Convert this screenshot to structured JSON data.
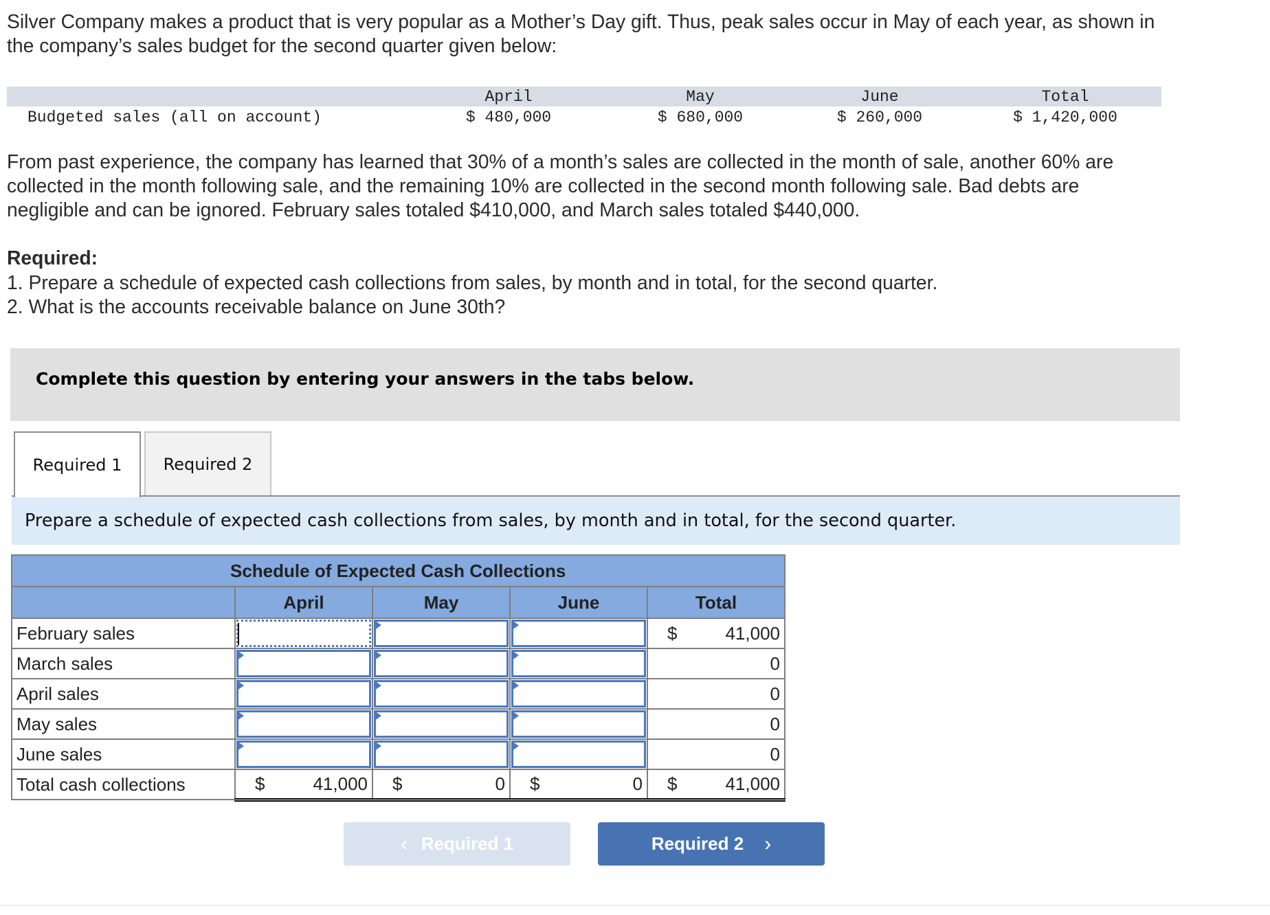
{
  "problem": {
    "intro_lines": [
      "Silver Company makes a product that is very popular as a Mother’s Day gift. Thus, peak sales occur in May of each year, as shown in",
      "the company’s sales budget for the second quarter given below:"
    ],
    "budget_table": {
      "row_label": "Budgeted sales (all on account)",
      "headers": [
        "April",
        "May",
        "June",
        "Total"
      ],
      "values": [
        "$ 480,000",
        "$ 680,000",
        "$ 260,000",
        "$ 1,420,000"
      ]
    },
    "collection_lines": [
      "From past experience, the company has learned that 30% of a month’s sales are collected in the month of sale, another 60% are",
      "collected in the month following sale, and the remaining 10% are collected in the second month following sale. Bad debts are",
      "negligible and can be ignored. February sales totaled $410,000, and March sales totaled $440,000."
    ],
    "required_heading": "Required:",
    "required_items": [
      "1. Prepare a schedule of expected cash collections from sales, by month and in total, for the second quarter.",
      "2. What is the accounts receivable balance on June 30th?"
    ]
  },
  "instructions_box": "Complete this question by entering your answers in the tabs below.",
  "tabs": [
    {
      "label": "Required 1",
      "active": true
    },
    {
      "label": "Required 2",
      "active": false
    }
  ],
  "tab_instruction": "Prepare a schedule of expected cash collections from sales, by month and in total, for the second quarter.",
  "schedule": {
    "title": "Schedule of Expected Cash Collections",
    "columns": [
      "April",
      "May",
      "June",
      "Total"
    ],
    "rows": [
      {
        "label": "February sales",
        "inputs": [
          "",
          "",
          ""
        ],
        "total_symbol": "$",
        "total": "41,000"
      },
      {
        "label": "March sales",
        "inputs": [
          "",
          "",
          ""
        ],
        "total_symbol": "",
        "total": "0"
      },
      {
        "label": "April sales",
        "inputs": [
          "",
          "",
          ""
        ],
        "total_symbol": "",
        "total": "0"
      },
      {
        "label": "May sales",
        "inputs": [
          "",
          "",
          ""
        ],
        "total_symbol": "",
        "total": "0"
      },
      {
        "label": "June sales",
        "inputs": [
          "",
          "",
          ""
        ],
        "total_symbol": "",
        "total": "0"
      }
    ],
    "total_row": {
      "label": "Total cash collections",
      "symbol": "$",
      "values": [
        "41,000",
        "0",
        "0",
        "41,000"
      ]
    }
  },
  "nav": {
    "prev_label": "Required 1",
    "next_label": "Required 2",
    "prev_chevron": "‹",
    "next_chevron": "›",
    "prev_enabled": false
  },
  "colors": {
    "accent": "#4873b3",
    "table_header": "#84aadf",
    "input_border": "#4a78c2",
    "instruction_bg": "#ddeaf7"
  }
}
